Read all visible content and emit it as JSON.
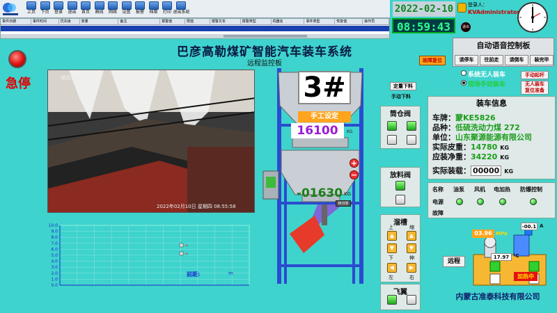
{
  "toolbar": {
    "buttons": [
      {
        "label": "上页",
        "icon": "page-up-icon"
      },
      {
        "label": "下页",
        "icon": "page-down-icon"
      },
      {
        "label": "登录",
        "icon": "login-icon"
      },
      {
        "label": "退出",
        "icon": "logout-icon"
      },
      {
        "label": "首页",
        "icon": "home-icon"
      },
      {
        "label": "曲线",
        "icon": "curve-icon"
      },
      {
        "label": "网络",
        "icon": "network-icon"
      },
      {
        "label": "设置",
        "icon": "settings-icon"
      },
      {
        "label": "报警",
        "icon": "alarm-icon"
      },
      {
        "label": "档案",
        "icon": "archive-icon"
      },
      {
        "label": "打印",
        "icon": "print-icon"
      },
      {
        "label": "退出系统",
        "icon": "exit-system-icon"
      }
    ]
  },
  "alarm_table": {
    "columns": [
      "事件日期",
      "事件时间",
      "优先级",
      "变量",
      "备注",
      "报警值",
      "限值",
      "报警文本",
      "报警类型",
      "机器名",
      "事件类型",
      "恢复值",
      "操作员"
    ]
  },
  "header": {
    "date": "2022-02-10",
    "time": "08:59:43",
    "user_label": "登录人：",
    "user_name": "KVAdministrator",
    "exit_label": "退出"
  },
  "title": "巴彦高勒煤矿智能汽车装车系统",
  "subtitle": "远程监控板",
  "emergency_stop": "急停",
  "camera": {
    "top_text": "播煤头车尾",
    "bottom_text": "2022年02月10日 星期四 08:55:58"
  },
  "chart_data": {
    "type": "line",
    "y_ticks": [
      "0.0",
      "1.0",
      "2.0",
      "3.0",
      "4.0",
      "5.0",
      "6.0",
      "7.0",
      "8.0",
      "9.0",
      "10.0"
    ],
    "ylim": [
      0,
      10
    ],
    "x_ticks": [
      "",
      "",
      "",
      "",
      "",
      "",
      "",
      "",
      "",
      "",
      "",
      ""
    ],
    "legend": [
      "",
      ""
    ],
    "grid": true,
    "series": []
  },
  "distance": {
    "label": "前距:",
    "value": "",
    "unit": "m"
  },
  "silo": {
    "number": "3#",
    "manual_set_label": "手工设定",
    "setpoint": "16100",
    "setpoint_unit": "KG",
    "weight": "-01630",
    "weight_unit": "KG",
    "zero_label": "称归零"
  },
  "controls": {
    "fixed_discharge": "定量下料",
    "manual_discharge": "手动下料",
    "fault_reset": "故障复位",
    "silo_gate_title": "筒仓阀",
    "discharge_valve_title": "放料阀",
    "chute_title": "溜槽",
    "chute_labels": {
      "up": "上",
      "extend": "伸",
      "down": "下",
      "retract": "缩",
      "left": "左",
      "right": "右"
    },
    "flying_wing_title": "飞翼"
  },
  "voice_panel": {
    "title": "自动语音控制板",
    "buttons": [
      "请停车",
      "往前走",
      "请倒车",
      "装完毕"
    ]
  },
  "modes": {
    "unmanned": "系统无人装车",
    "local_manual": "现场手动装车",
    "manual_start": "手动起杆",
    "unmanned_reset_1": "无人装车",
    "unmanned_reset_2": "复位准备"
  },
  "load_info": {
    "title": "装车信息",
    "plate_label": "车牌：",
    "plate": "蒙KE5826",
    "variety_label": "品种：",
    "variety": "低硫洗动力煤 272",
    "unit_label": "单位：",
    "unit": "山东聚源能源有限公司",
    "tare_label": "实际皮重：",
    "tare": "14780",
    "net_label": "应装净重：",
    "net": "34220",
    "actual_label": "实际装载：",
    "actual": "00000",
    "weight_unit": "KG"
  },
  "equipment": {
    "headers": [
      "名称",
      "油泵",
      "风机",
      "电加热",
      "防爆控制"
    ],
    "rows": [
      "电源",
      "故障"
    ]
  },
  "pump": {
    "pressure": "03.96",
    "pressure_unit": "MPa",
    "current": "-00.1",
    "current_unit": "A",
    "temperature": "17.97",
    "temperature_unit": "°C",
    "remote_label": "远程",
    "heating_label": "加热中"
  },
  "company": "内蒙古准泰科技有限公司"
}
